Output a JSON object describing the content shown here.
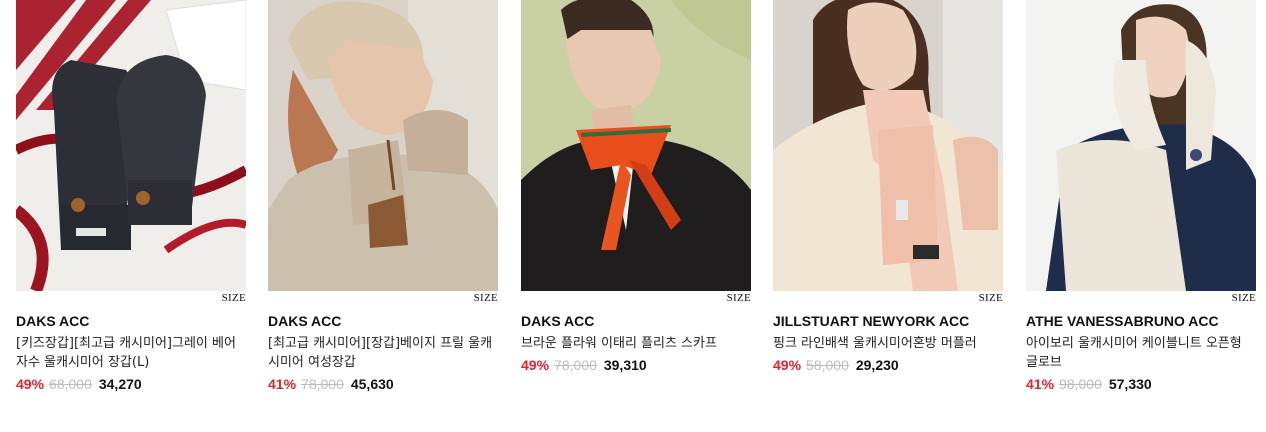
{
  "products": [
    {
      "size_label": "SIZE",
      "brand": "DAKS ACC",
      "name": "[키즈장갑][최고급 캐시미어]그레이 베어 자수 울캐시미어 장갑(L)",
      "discount": "49%",
      "original_price": "68,000",
      "sale_price": "34,270",
      "image_desc": "gray-knit-gloves-with-bear-embroidery"
    },
    {
      "size_label": "SIZE",
      "brand": "DAKS ACC",
      "name": "[최고급 캐시미어][장갑]베이지 프릴 울캐시미어 여성장갑",
      "discount": "41%",
      "original_price": "78,000",
      "sale_price": "45,630",
      "image_desc": "model-in-beige-bucket-hat-and-gloves"
    },
    {
      "size_label": "SIZE",
      "brand": "DAKS ACC",
      "name": "브라운 플라워 이태리 플리츠 스카프",
      "discount": "49%",
      "original_price": "78,000",
      "sale_price": "39,310",
      "image_desc": "model-wearing-orange-pleated-scarf"
    },
    {
      "size_label": "SIZE",
      "brand": "JILLSTUART NEWYORK ACC",
      "name": "핑크 라인배색 울캐시미어혼방 머플러",
      "discount": "49%",
      "original_price": "58,000",
      "sale_price": "29,230",
      "image_desc": "model-wearing-pink-knit-muffler"
    },
    {
      "size_label": "SIZE",
      "brand": "ATHE VANESSABRUNO ACC",
      "name": "아이보리 울캐시미어 케이블니트 오픈형 글로브",
      "discount": "41%",
      "original_price": "98,000",
      "sale_price": "57,330",
      "image_desc": "model-wearing-ivory-cable-knit-gloves"
    }
  ]
}
